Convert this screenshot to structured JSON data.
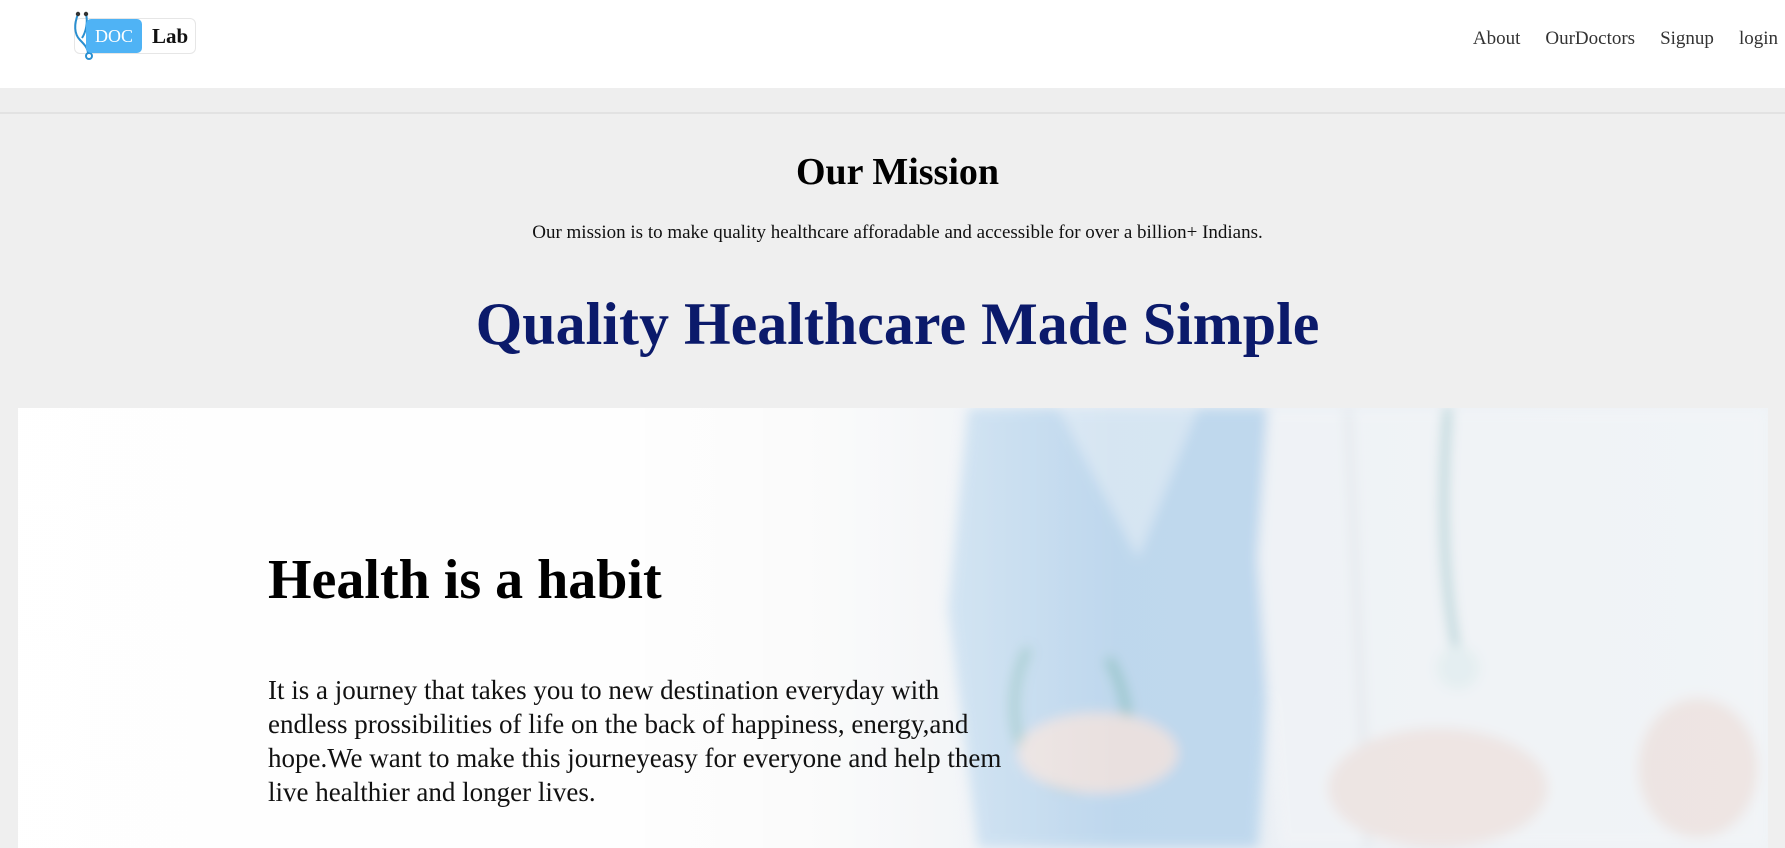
{
  "logo": {
    "doc": "DOC",
    "lab": "Lab"
  },
  "nav": {
    "items": [
      "About",
      "OurDoctors",
      "Signup",
      "login"
    ]
  },
  "mission": {
    "title": "Our Mission",
    "text": "Our mission is to make quality healthcare afforadable and accessible for over a billion+ Indians."
  },
  "tagline": "Quality Healthcare Made Simple",
  "hero": {
    "heading": "Health is a habit",
    "text": "It is a journey that takes you to new destination everyday with endless prossibilities of life on the back of happiness, energy,and hope.We want to make this journeyeasy for everyone and help them live healthier and longer lives."
  },
  "colors": {
    "tagline": "#0b1a6b",
    "logo_accent": "#4fb3f5"
  }
}
